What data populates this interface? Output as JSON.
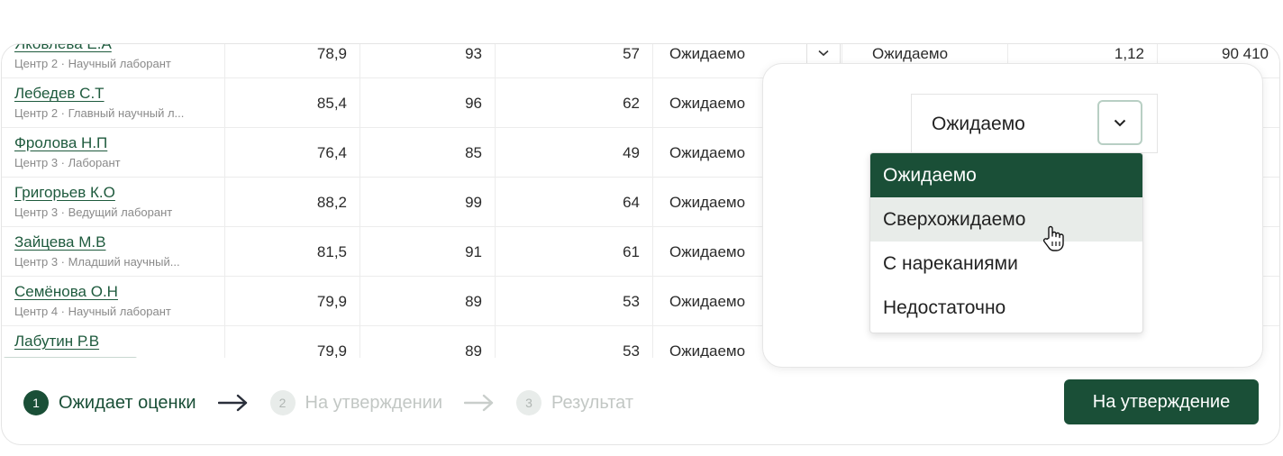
{
  "rows": [
    {
      "name": "Яковлева Е.А",
      "sub": "Центр 2 · Научный лаборант",
      "v1": "78,9",
      "v2": "93",
      "v3": "57",
      "sel": "Ожидаемо",
      "sel2": "Ожидаемо",
      "v4": "1,12",
      "v5": "90 410"
    },
    {
      "name": "Лебедев С.Т",
      "sub": "Центр 2 · Главный научный л...",
      "v1": "85,4",
      "v2": "96",
      "v3": "62",
      "sel": "Ожидаемо"
    },
    {
      "name": "Фролова Н.П",
      "sub": "Центр 3 · Лаборант",
      "v1": "76,4",
      "v2": "85",
      "v3": "49",
      "sel": "Ожидаемо"
    },
    {
      "name": "Григорьев К.О",
      "sub": "Центр 3 · Ведущий лаборант",
      "v1": "88,2",
      "v2": "99",
      "v3": "64",
      "sel": "Ожидаемо"
    },
    {
      "name": "Зайцева М.В",
      "sub": "Центр 3 · Младший научный...",
      "v1": "81,5",
      "v2": "91",
      "v3": "61",
      "sel": "Ожидаемо"
    },
    {
      "name": "Семёнова О.Н",
      "sub": "Центр 4 · Научный лаборант",
      "v1": "79,9",
      "v2": "89",
      "v3": "53",
      "sel": "Ожидаемо"
    },
    {
      "name": "Лабутин Р.В",
      "sub": "",
      "v1": "79,9",
      "v2": "89",
      "v3": "53",
      "sel": "Ожидаемо"
    }
  ],
  "dropdown": {
    "value": "Ожидаемо",
    "options": [
      "Ожидаемо",
      "Сверхожидаемо",
      "С нареканиями",
      "Недостаточно"
    ],
    "selected_index": 0,
    "hover_index": 1
  },
  "steps": [
    {
      "num": "1",
      "label": "Ожидает оценки",
      "active": true
    },
    {
      "num": "2",
      "label": "На утверждении",
      "active": false
    },
    {
      "num": "3",
      "label": "Результат",
      "active": false
    }
  ],
  "action_button": "На утверждение",
  "colors": {
    "accent": "#1a4f37",
    "link": "#1e5a3d",
    "hover": "#e8ece9",
    "inactive": "#c2c7c4"
  },
  "icons": {
    "chevron": "chevron-down-icon",
    "arrow": "arrow-right-icon",
    "cursor": "hand-pointer-icon"
  }
}
